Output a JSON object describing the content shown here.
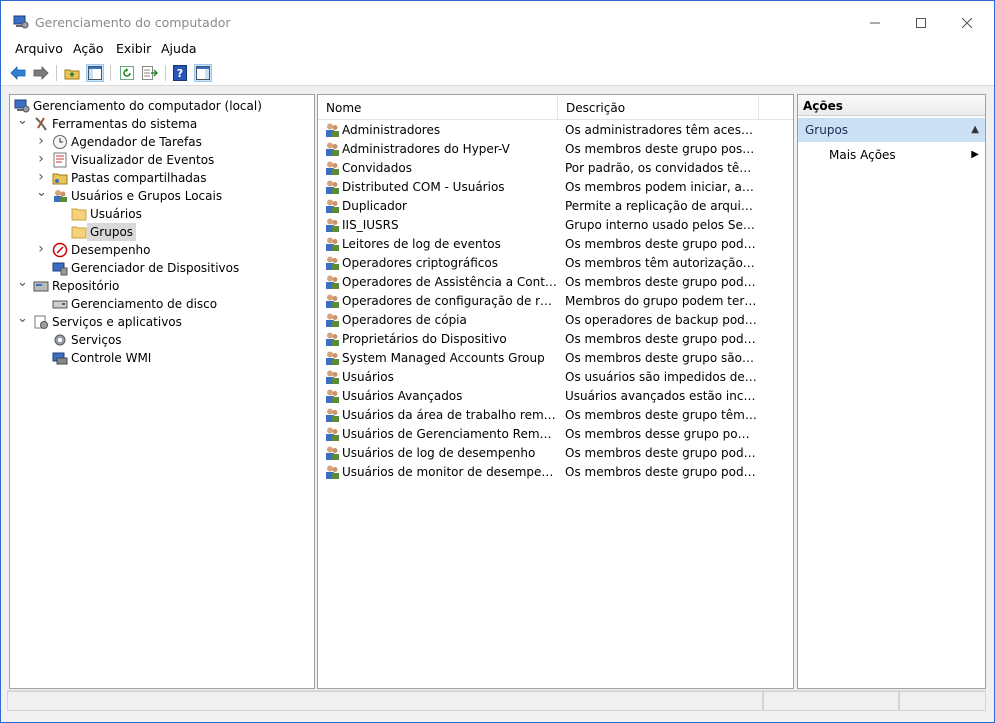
{
  "window": {
    "title": "Gerenciamento do computador"
  },
  "menu": [
    "Arquivo",
    "Ação",
    "Exibir",
    "Ajuda"
  ],
  "toolbar_icons": [
    "back-arrow-icon",
    "forward-arrow-icon",
    "up-folder-icon",
    "show-hide-tree-icon",
    "refresh-icon",
    "export-list-icon",
    "help-icon",
    "action-pane-icon"
  ],
  "tree": [
    {
      "label": "Gerenciamento do computador (local)",
      "level": 0,
      "expander": "none",
      "icon": "computer-management-icon"
    },
    {
      "label": "Ferramentas do sistema",
      "level": 1,
      "expander": "expanded",
      "icon": "system-tools-icon"
    },
    {
      "label": "Agendador de Tarefas",
      "level": 2,
      "expander": "collapsed",
      "icon": "clock-icon"
    },
    {
      "label": "Visualizador de Eventos",
      "level": 2,
      "expander": "collapsed",
      "icon": "event-viewer-icon"
    },
    {
      "label": "Pastas compartilhadas",
      "level": 2,
      "expander": "collapsed",
      "icon": "shared-folder-icon"
    },
    {
      "label": "Usuários e Grupos Locais",
      "level": 2,
      "expander": "expanded",
      "icon": "users-groups-icon"
    },
    {
      "label": "Usuários",
      "level": 3,
      "expander": "none",
      "icon": "folder-icon"
    },
    {
      "label": "Grupos",
      "level": 3,
      "expander": "none",
      "icon": "folder-icon",
      "selected": true
    },
    {
      "label": "Desempenho",
      "level": 2,
      "expander": "collapsed",
      "icon": "performance-icon"
    },
    {
      "label": "Gerenciador de Dispositivos",
      "level": 2,
      "expander": "none",
      "icon": "device-manager-icon"
    },
    {
      "label": "Repositório",
      "level": 1,
      "expander": "expanded",
      "icon": "storage-icon"
    },
    {
      "label": "Gerenciamento de disco",
      "level": 2,
      "expander": "none",
      "icon": "disk-icon"
    },
    {
      "label": "Serviços e aplicativos",
      "level": 1,
      "expander": "expanded",
      "icon": "services-apps-icon"
    },
    {
      "label": "Serviços",
      "level": 2,
      "expander": "none",
      "icon": "gear-icon"
    },
    {
      "label": "Controle WMI",
      "level": 2,
      "expander": "none",
      "icon": "wmi-icon"
    }
  ],
  "list": {
    "columns": {
      "name": "Nome",
      "description": "Descrição"
    },
    "rows": [
      {
        "name": "Administradores",
        "description": "Os administradores têm acesso c..."
      },
      {
        "name": "Administradores do Hyper-V",
        "description": "Os membros deste grupo possue..."
      },
      {
        "name": "Convidados",
        "description": "Por padrão, os convidados têm o ..."
      },
      {
        "name": "Distributed COM - Usuários",
        "description": "Os membros podem iniciar, ativar..."
      },
      {
        "name": "Duplicador",
        "description": "Permite a replicação de arquivos ..."
      },
      {
        "name": "IIS_IUSRS",
        "description": "Grupo interno usado pelos Serviç..."
      },
      {
        "name": "Leitores de log de eventos",
        "description": "Os membros deste grupo podem ..."
      },
      {
        "name": "Operadores criptográficos",
        "description": "Os membros têm autorização par..."
      },
      {
        "name": "Operadores de Assistência a Controle d...",
        "description": "Os membros deste grupo podem ..."
      },
      {
        "name": "Operadores de configuração de rede",
        "description": "Membros do grupo podem ter al..."
      },
      {
        "name": "Operadores de cópia",
        "description": "Os operadores de backup podem ..."
      },
      {
        "name": "Proprietários do Dispositivo",
        "description": "Os membros deste grupo podem ..."
      },
      {
        "name": "System Managed Accounts Group",
        "description": "Os membros deste grupo são ger..."
      },
      {
        "name": "Usuários",
        "description": "Os usuários são impedidos de faz..."
      },
      {
        "name": "Usuários Avançados",
        "description": "Usuários avançados estão incluíd..."
      },
      {
        "name": "Usuários da área de trabalho remota",
        "description": "Os membros deste grupo têm dir..."
      },
      {
        "name": "Usuários de Gerenciamento Remoto",
        "description": "Os membros desse grupo podem ..."
      },
      {
        "name": "Usuários de log de desempenho",
        "description": "Os membros deste grupo podem ..."
      },
      {
        "name": "Usuários de monitor de desempenho",
        "description": "Os membros deste grupo podem ..."
      }
    ]
  },
  "actions": {
    "header": "Ações",
    "section": "Grupos",
    "items": [
      "Mais Ações"
    ]
  },
  "colors": {
    "selection_bg": "#cce0f5",
    "window_border": "#2f6ad0",
    "desktop": "#1565d8"
  }
}
